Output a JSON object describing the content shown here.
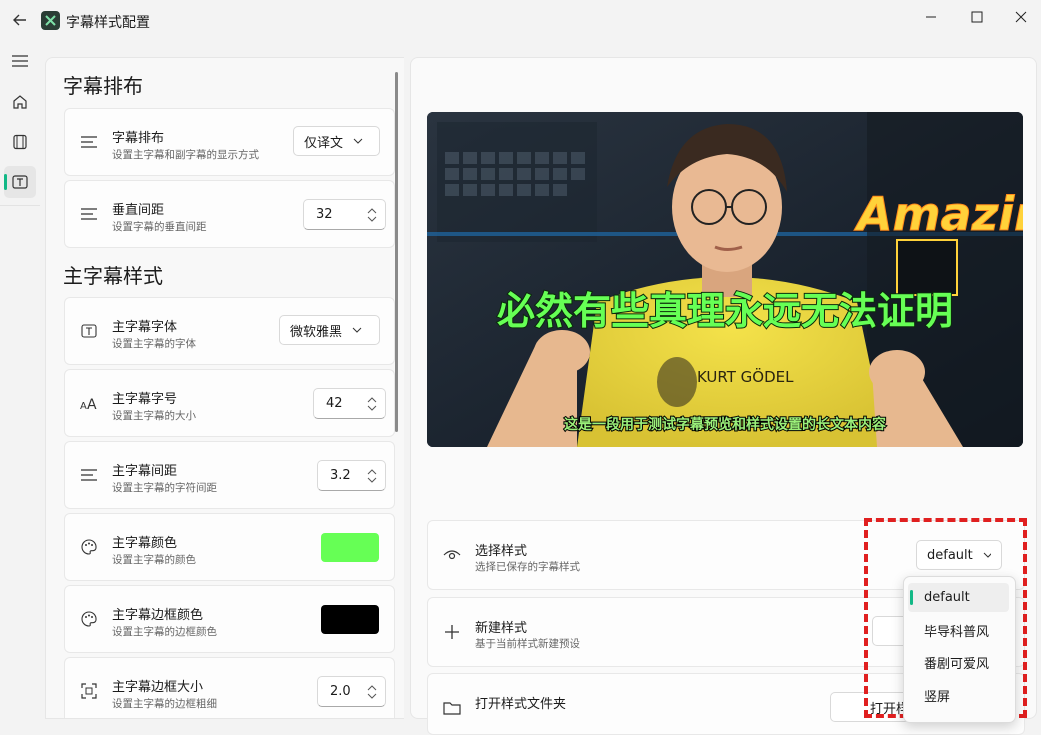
{
  "window": {
    "title": "字幕样式配置"
  },
  "sections": {
    "layout": "字幕排布",
    "main_style": "主字幕样式"
  },
  "settings": [
    {
      "title": "字幕排布",
      "desc": "设置主字幕和副字幕的显示方式",
      "value": "仅译文"
    },
    {
      "title": "垂直间距",
      "desc": "设置字幕的垂直间距",
      "value": "32"
    },
    {
      "title": "主字幕字体",
      "desc": "设置主字幕的字体",
      "value": "微软雅黑"
    },
    {
      "title": "主字幕字号",
      "desc": "设置主字幕的大小",
      "value": "42"
    },
    {
      "title": "主字幕间距",
      "desc": "设置主字幕的字符间距",
      "value": "3.2"
    },
    {
      "title": "主字幕颜色",
      "desc": "设置主字幕的颜色",
      "color": "#66ff55"
    },
    {
      "title": "主字幕边框颜色",
      "desc": "设置主字幕的边框颜色",
      "color": "#000000"
    },
    {
      "title": "主字幕边框大小",
      "desc": "设置主字幕的边框粗细",
      "value": "2.0"
    }
  ],
  "preview": {
    "main_subtitle": "必然有些真理永远无法证明",
    "sub_subtitle": "这是一段用于测试字幕预览和样式设置的长文本内容",
    "neon_sign": "Amazin",
    "shirt_text": "KURT GÖDEL"
  },
  "style_cards": [
    {
      "title": "选择样式",
      "desc": "选择已保存的字幕样式",
      "value": "default"
    },
    {
      "title": "新建样式",
      "desc": "基于当前样式新建预设"
    },
    {
      "title": "打开样式文件夹",
      "button": "打开样"
    }
  ],
  "style_menu": {
    "items": [
      "default",
      "毕导科普风",
      "番剧可爱风",
      "竖屏"
    ],
    "selected_index": 0
  },
  "colors": {
    "accent": "#12b886",
    "highlight": "#e02020"
  }
}
